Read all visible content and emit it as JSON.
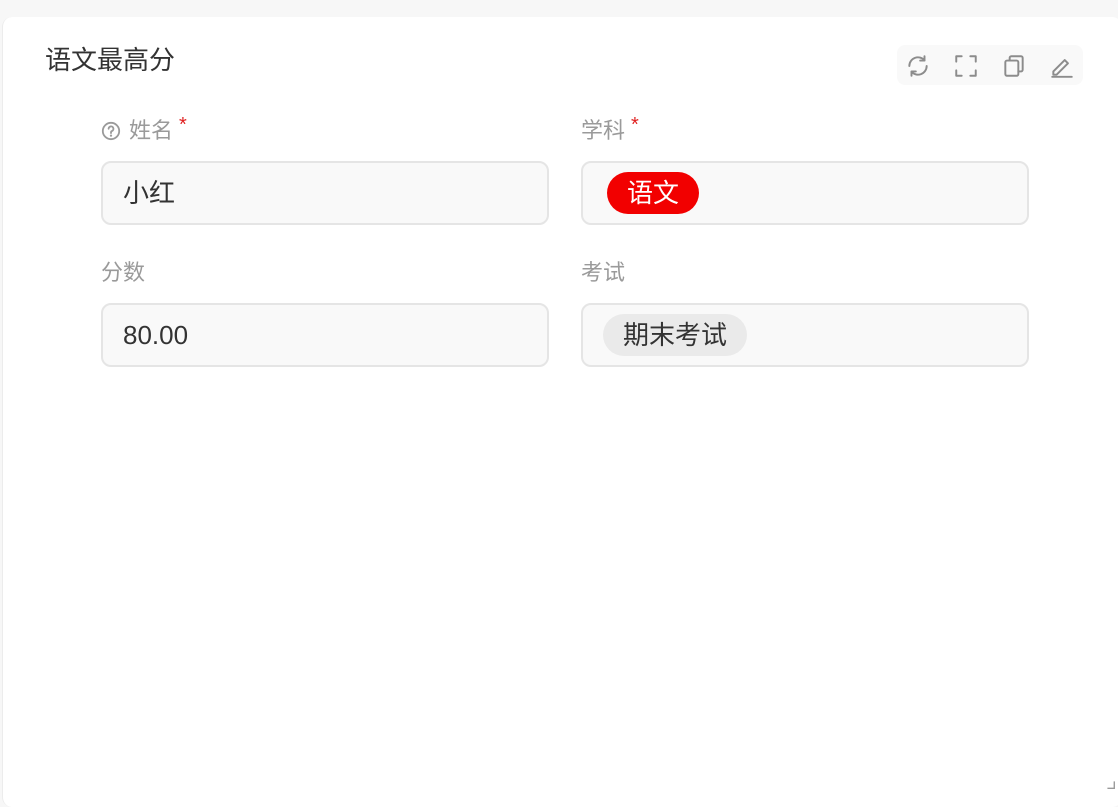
{
  "card": {
    "title": "语文最高分"
  },
  "toolbar": {
    "items": [
      {
        "icon": "refresh-icon"
      },
      {
        "icon": "fullscreen-icon"
      },
      {
        "icon": "copy-icon"
      },
      {
        "icon": "edit-icon"
      }
    ]
  },
  "form": {
    "name": {
      "label": "姓名",
      "required_mark": "*",
      "value": "小红"
    },
    "subject": {
      "label": "学科",
      "required_mark": "*",
      "tag": "语文",
      "tag_color": "#f20000"
    },
    "score": {
      "label": "分数",
      "value": "80.00"
    },
    "exam": {
      "label": "考试",
      "tag": "期末考试"
    }
  }
}
